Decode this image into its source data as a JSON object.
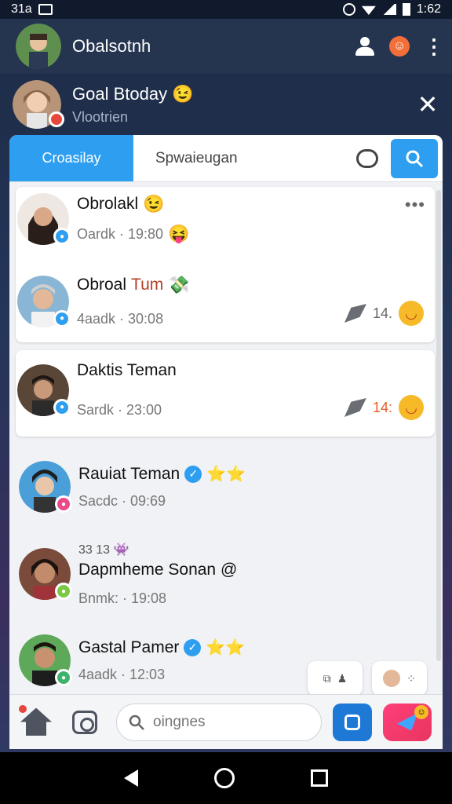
{
  "status_bar": {
    "left_text": "31a",
    "time": "1:62"
  },
  "header": {
    "title": "Obalsotnh"
  },
  "banner": {
    "title": "Goal Btoday",
    "subtitle": "Vlootrien",
    "emoji": "😉"
  },
  "tabs": {
    "active": "Croasilay",
    "second": "Spwaieugan"
  },
  "chats": [
    {
      "name": "Obrolakl",
      "name_emoji": "😉",
      "meta": "Oardk · 19:80",
      "meta_emoji": "😝",
      "badge_color": "#2e9ff0",
      "avatar_color": "#c9a58d"
    },
    {
      "name": "Obroal",
      "name_accent": "Tum",
      "name_emoji": "💸",
      "meta": "4aadk · 30:08",
      "count": "14.",
      "badge_color": "#2e9ff0",
      "avatar_color": "#8ab6d6"
    },
    {
      "name": "Daktis Teman",
      "meta": "Sardk · 23:00",
      "count": "14:",
      "badge_color": "#2e9ff0",
      "avatar_color": "#5a4636"
    },
    {
      "name": "Rauiat Teman",
      "meta": "Sacdc · 09:69",
      "badge_color": "#e84a8a",
      "avatar_color": "#4a9fd8",
      "stars": "⭐⭐"
    },
    {
      "pre": "33 13",
      "pre_emoji": "👾",
      "name": "Dapmheme Sonan @",
      "meta": "Bnmk: · 19:08",
      "badge_color": "#7ac943",
      "avatar_color": "#7a4a3a"
    },
    {
      "name": "Gastal Pamer",
      "meta": "4aadk · 12:03",
      "badge_color": "#3db36b",
      "avatar_color": "#5ea85a",
      "stars": "⭐⭐"
    }
  ],
  "search": {
    "placeholder": "oingnes"
  },
  "icons": [
    "person-icon",
    "smile-icon",
    "more-icon",
    "close-icon",
    "cloud-icon",
    "search-icon",
    "home-icon",
    "camera-icon",
    "square-icon",
    "send-icon",
    "back-icon",
    "home-circle-icon",
    "recents-icon"
  ]
}
